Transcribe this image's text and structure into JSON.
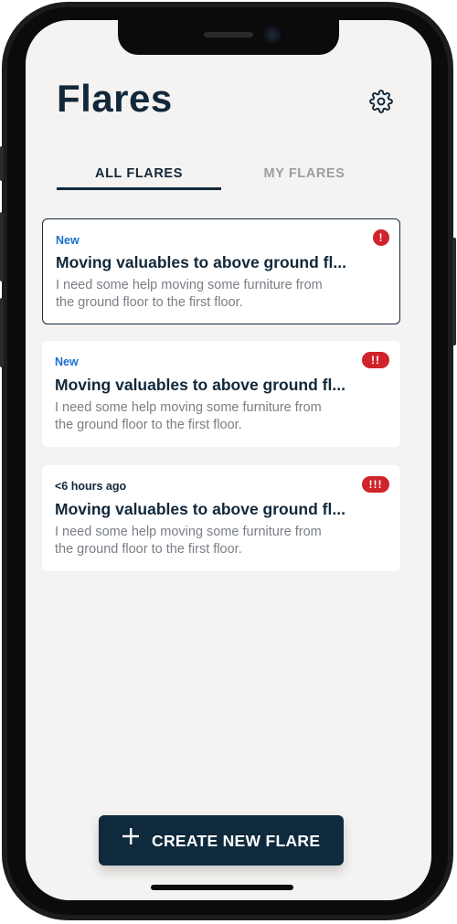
{
  "app": {
    "title": "Flares"
  },
  "tabs": [
    {
      "label": "ALL FLARES",
      "active": true
    },
    {
      "label": "MY FLARES",
      "active": false
    }
  ],
  "flares": [
    {
      "status": "New",
      "title": "Moving valuables to above ground fl...",
      "description_line1": "I need some help moving some furniture from",
      "description_line2": "the ground floor to the first floor.",
      "priority": "!",
      "selected": true
    },
    {
      "status": "New",
      "title": "Moving valuables to above ground fl...",
      "description_line1": "I need some help moving some furniture from",
      "description_line2": "the ground floor to the first floor.",
      "priority": "!!",
      "selected": false
    },
    {
      "status": "<6 hours ago",
      "title": "Moving valuables to above ground fl...",
      "description_line1": "I need some help moving some furniture from",
      "description_line2": "the ground floor to the first floor.",
      "priority": "!!!",
      "selected": false
    }
  ],
  "create_button": {
    "label": "CREATE NEW FLARE",
    "icon": "plus-icon"
  },
  "icons": {
    "settings": "gear-icon"
  },
  "colors": {
    "primary": "#12283a",
    "accent_new": "#1a6fcf",
    "priority": "#d0232b",
    "background": "#f5f3f1",
    "muted_text": "#7a7f85"
  }
}
